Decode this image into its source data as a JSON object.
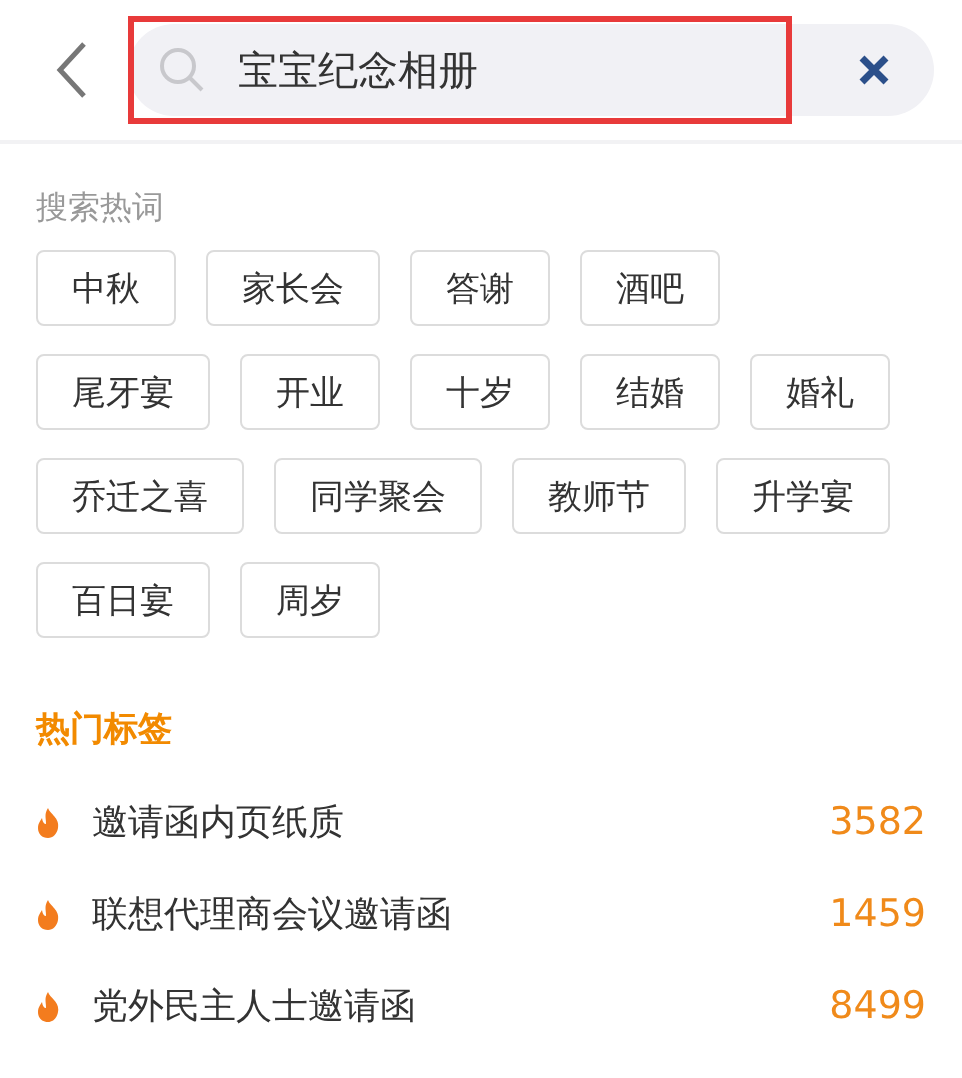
{
  "search": {
    "value": "宝宝纪念相册",
    "highlighted": true
  },
  "hot_words": {
    "title": "搜索热词",
    "items": [
      "中秋",
      "家长会",
      "答谢",
      "酒吧",
      "尾牙宴",
      "开业",
      "十岁",
      "结婚",
      "婚礼",
      "乔迁之喜",
      "同学聚会",
      "教师节",
      "升学宴",
      "百日宴",
      "周岁"
    ]
  },
  "hot_tags": {
    "title": "热门标签",
    "items": [
      {
        "label": "邀请函内页纸质",
        "count": "3582"
      },
      {
        "label": "联想代理商会议邀请函",
        "count": "1459"
      },
      {
        "label": "党外民主人士邀请函",
        "count": "8499"
      }
    ]
  }
}
